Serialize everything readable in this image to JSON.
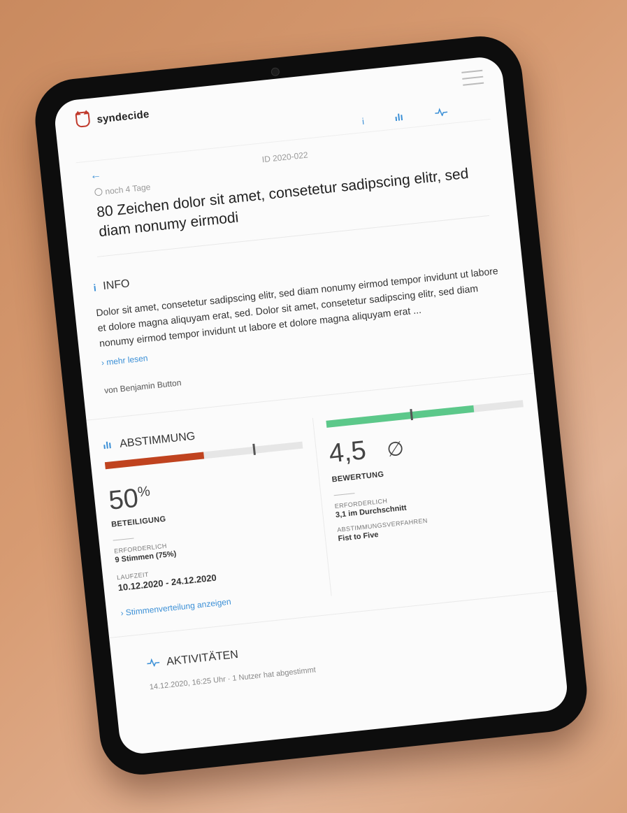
{
  "brand": {
    "name": "syndecide"
  },
  "subnav": {
    "info_icon": "i",
    "chart_icon": "bar-chart-icon",
    "activity_icon": "pulse-icon"
  },
  "header": {
    "back_icon": "←",
    "id_label": "ID 2020-022",
    "deadline": "noch 4 Tage"
  },
  "title": "80 Zeichen dolor sit amet, consetetur sadipscing elitr, sed diam nonumy eirmodi",
  "info": {
    "heading": "INFO",
    "text": "Dolor sit amet, consetetur sadipscing elitr, sed diam nonumy eirmod tempor invidunt ut labore et dolore magna aliquyam erat, sed. Dolor sit amet, consetetur sadipscing elitr, sed diam nonumy eirmod tempor invidunt ut labore et dolore magna aliquyam erat ...",
    "more": "› mehr lesen",
    "author": "von Benjamin Button"
  },
  "vote": {
    "heading": "ABSTIMMUNG",
    "participation": {
      "value": "50",
      "unit": "%",
      "label": "BETEILIGUNG",
      "fill": 0.5,
      "marker": 0.75,
      "fill_color": "#c0431f",
      "required_label": "ERFORDERLICH",
      "required_value": "9 Stimmen (75%)",
      "duration_label": "LAUFZEIT",
      "duration_value": "10.12.2020 - 24.12.2020",
      "link": "› Stimmenverteilung anzeigen"
    },
    "rating": {
      "value": "4,5",
      "symbol": "∅",
      "label": "BEWERTUNG",
      "fill": 0.75,
      "marker": 0.43,
      "fill_color": "#5cc88a",
      "required_label": "ERFORDERLICH",
      "required_value": "3,1 im Durchschnitt",
      "method_label": "ABSTIMMUNGSVERFAHREN",
      "method_value": "Fist to Five"
    }
  },
  "activities": {
    "heading": "AKTIVITÄTEN",
    "first_entry": "14.12.2020, 16:25 Uhr · 1 Nutzer hat abgestimmt"
  }
}
